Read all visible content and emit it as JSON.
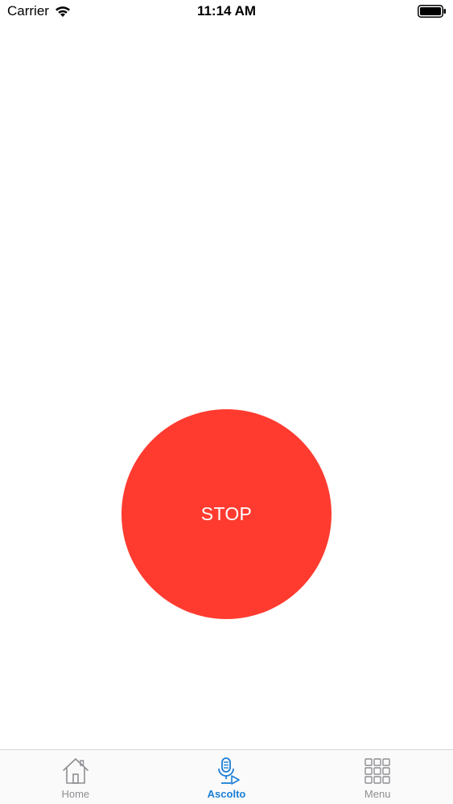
{
  "status_bar": {
    "carrier": "Carrier",
    "time": "11:14 AM",
    "wifi_icon": "wifi-icon",
    "battery_icon": "battery-icon"
  },
  "main": {
    "stop_button_label": "STOP",
    "stop_button_color": "#ff3b30"
  },
  "tab_bar": {
    "active_color": "#1a7fd6",
    "inactive_color": "#8e8e93",
    "tabs": [
      {
        "label": "Home",
        "icon": "home-icon",
        "active": false
      },
      {
        "label": "Ascolto",
        "icon": "microphone-icon",
        "active": true
      },
      {
        "label": "Menu",
        "icon": "grid-icon",
        "active": false
      }
    ]
  }
}
